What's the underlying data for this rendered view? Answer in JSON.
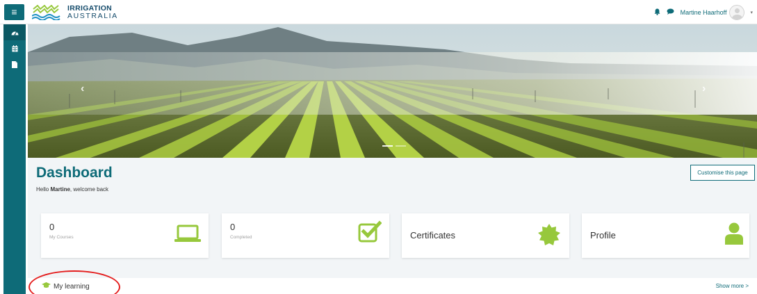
{
  "header": {
    "menu_icon": "hamburger-icon",
    "logo_line1": "IRRIGATION",
    "logo_line2": "AUSTRALIA",
    "notification_icon": "bell-icon",
    "message_icon": "chat-icon",
    "user_name": "Martine Haarhoff",
    "caret": "▾"
  },
  "sidebar": {
    "items": [
      {
        "icon": "dashboard-icon"
      },
      {
        "icon": "calendar-icon"
      },
      {
        "icon": "file-icon"
      }
    ]
  },
  "hero": {
    "prev": "‹",
    "next": "›",
    "slide_count": 2
  },
  "dashboard": {
    "title": "Dashboard",
    "welcome_prefix": "Hello ",
    "welcome_name": "Martine",
    "welcome_suffix": ", welcome back",
    "customise_label": "Customise this page"
  },
  "cards": [
    {
      "value": "0",
      "label": "My Courses",
      "icon": "laptop-icon"
    },
    {
      "value": "0",
      "label": "Completed",
      "icon": "checkbox-icon"
    },
    {
      "title": "Certificates",
      "icon": "certificate-icon"
    },
    {
      "title": "Profile",
      "icon": "user-icon"
    }
  ],
  "learning": {
    "title": "My learning",
    "icon": "graduation-cap-icon",
    "show_more": "Show more >"
  },
  "colors": {
    "primary": "#0e6b78",
    "accent": "#97c83c",
    "annotation": "#e41e1e"
  }
}
